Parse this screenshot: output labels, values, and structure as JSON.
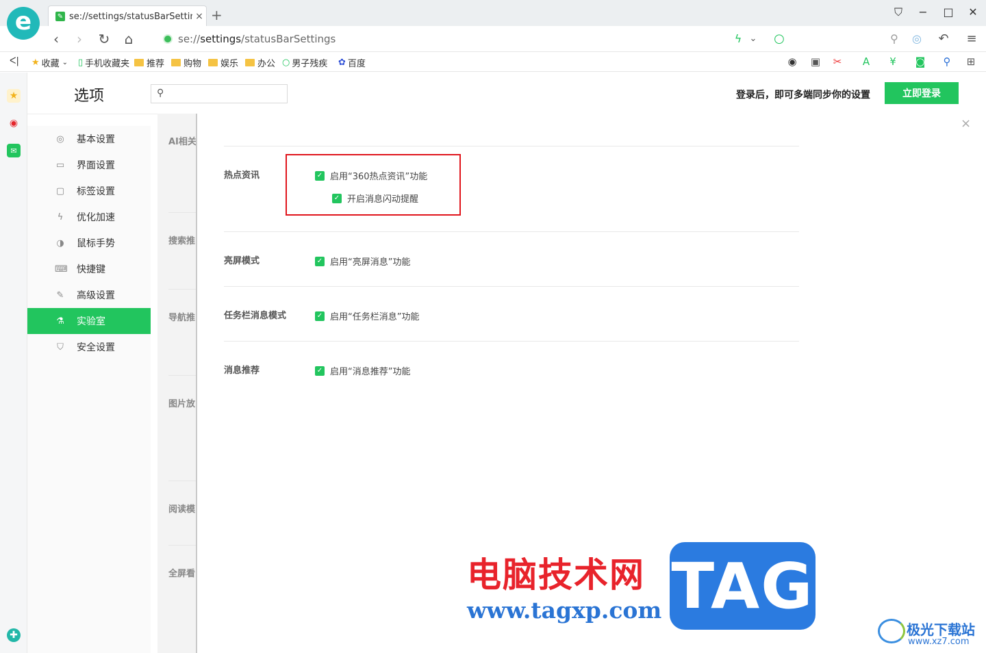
{
  "browser": {
    "tab_title": "se://settings/statusBarSettings",
    "tab_close": "×",
    "new_tab": "+",
    "url_prefix": "se://",
    "url_bold": "settings",
    "url_suffix": "/statusBarSettings"
  },
  "bookmarks": {
    "collapse": "ᐸ|",
    "items": [
      "收藏",
      "手机收藏夹",
      "推荐",
      "购物",
      "娱乐",
      "办公",
      "男子残疾",
      "百度"
    ]
  },
  "settings": {
    "title": "选项",
    "search_placeholder": "",
    "login_hint": "登录后，即可多端同步你的设置",
    "login_button": "立即登录",
    "close": "×"
  },
  "menu": {
    "items": [
      {
        "label": "基本设置",
        "icon": "◎"
      },
      {
        "label": "界面设置",
        "icon": "▭"
      },
      {
        "label": "标签设置",
        "icon": "▢"
      },
      {
        "label": "优化加速",
        "icon": "ϟ"
      },
      {
        "label": "鼠标手势",
        "icon": "◑"
      },
      {
        "label": "快捷键",
        "icon": "⌨"
      },
      {
        "label": "高级设置",
        "icon": "✎"
      },
      {
        "label": "实验室",
        "icon": "⚗"
      },
      {
        "label": "安全设置",
        "icon": "⛉"
      }
    ],
    "active_index": 7
  },
  "background_sections": [
    "AI相关",
    "搜索推",
    "导航推",
    "图片放",
    "阅读模",
    "全屏看"
  ],
  "sections": [
    {
      "title": "热点资讯",
      "options": [
        {
          "label": "启用“360热点资讯”功能",
          "checked": true
        },
        {
          "label": "开启消息闪动提醒",
          "checked": true
        }
      ]
    },
    {
      "title": "亮屏模式",
      "options": [
        {
          "label": "启用“亮屏消息”功能",
          "checked": true
        }
      ]
    },
    {
      "title": "任务栏消息模式",
      "options": [
        {
          "label": "启用“任务栏消息”功能",
          "checked": true
        }
      ]
    },
    {
      "title": "消息推荐",
      "options": [
        {
          "label": "启用“消息推荐”功能",
          "checked": true
        }
      ]
    }
  ],
  "watermark": {
    "cn": "电脑技术网",
    "url": "www.tagxp.com",
    "tag": "TAG",
    "site2_cn": "极光下载站",
    "site2_url": "www.xz7.com"
  },
  "colors": {
    "accent": "#22c55e",
    "highlight_box": "#e0141b"
  }
}
